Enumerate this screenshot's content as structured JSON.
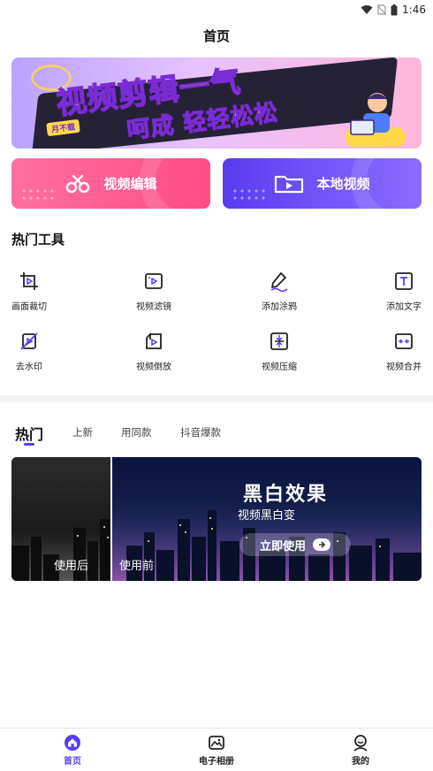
{
  "status_bar": {
    "time": "1:46"
  },
  "header": {
    "title": "首页"
  },
  "banner": {
    "line1": "视频剪辑一气",
    "line2": "呵成 轻轻松松",
    "tag": "月不载"
  },
  "actions": [
    {
      "label": "视频编辑",
      "icon": "scissors-icon"
    },
    {
      "label": "本地视频",
      "icon": "folder-icon"
    }
  ],
  "hot_tools": {
    "title": "热门工具",
    "items": [
      {
        "label": "画面裁切",
        "icon": "crop-icon"
      },
      {
        "label": "视频滤镜",
        "icon": "filter-icon"
      },
      {
        "label": "添加涂鸦",
        "icon": "pen-icon"
      },
      {
        "label": "添加文字",
        "icon": "text-icon"
      },
      {
        "label": "去水印",
        "icon": "watermark-icon"
      },
      {
        "label": "视频倒放",
        "icon": "reverse-icon"
      },
      {
        "label": "视频压缩",
        "icon": "compress-icon"
      },
      {
        "label": "视频合并",
        "icon": "merge-icon"
      }
    ]
  },
  "tabs": [
    {
      "label": "热门",
      "active": true
    },
    {
      "label": "上新",
      "active": false
    },
    {
      "label": "用同款",
      "active": false
    },
    {
      "label": "抖音爆款",
      "active": false
    }
  ],
  "feature": {
    "title": "黑白效果",
    "subtitle": "视频黑白变",
    "button": "立即使用",
    "after_label": "使用后",
    "before_label": "使用前"
  },
  "bottom_nav": [
    {
      "label": "首页",
      "icon": "home-icon",
      "active": true
    },
    {
      "label": "电子相册",
      "icon": "album-icon",
      "active": false
    },
    {
      "label": "我的",
      "icon": "profile-icon",
      "active": false
    }
  ],
  "colors": {
    "accent": "#5b3df5",
    "pink": "#ff4d86",
    "purple": "#6b4cf6"
  }
}
